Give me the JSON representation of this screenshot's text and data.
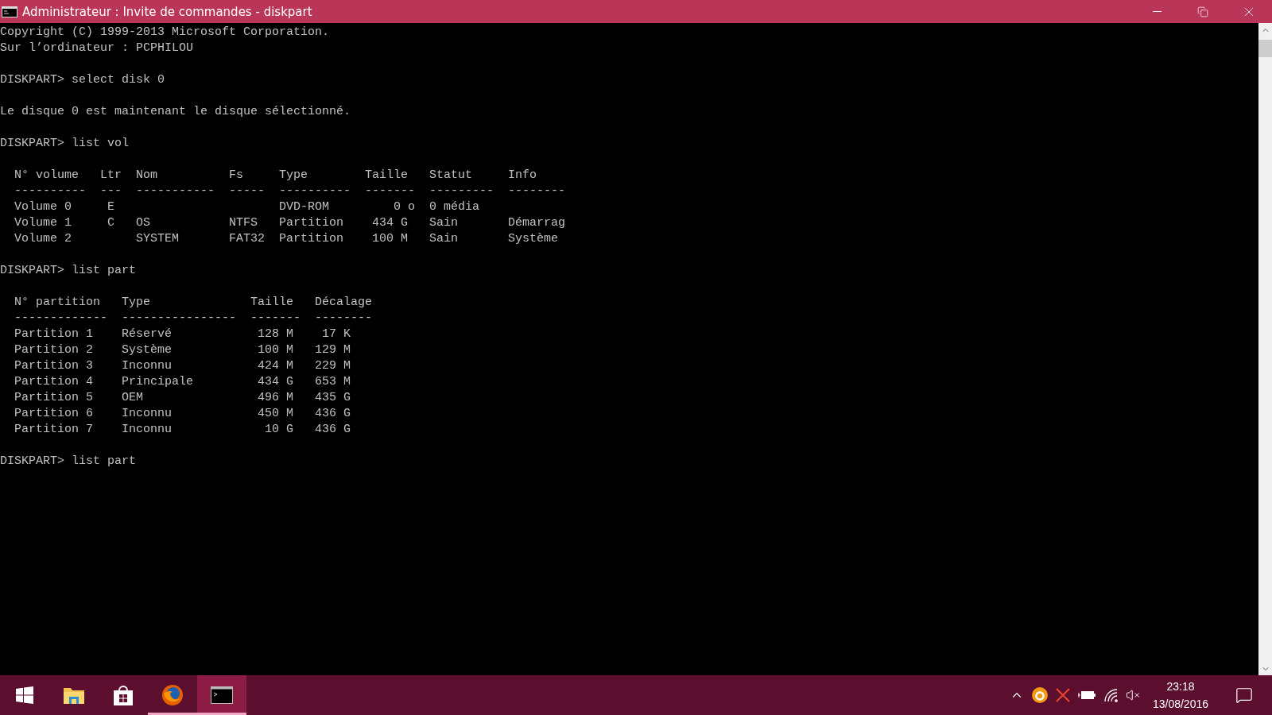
{
  "window": {
    "title": "Administrateur : Invite de commandes - diskpart"
  },
  "console": {
    "blocks": [
      [
        "Copyright (C) 1999-2013 Microsoft Corporation.",
        "Sur l’ordinateur : PCPHILOU"
      ],
      [
        "DISKPART> select disk 0"
      ],
      [
        "Le disque 0 est maintenant le disque sélectionné."
      ],
      [
        "DISKPART> list vol"
      ],
      [
        "  N° volume   Ltr  Nom          Fs     Type        Taille   Statut     Info",
        "  ----------  ---  -----------  -----  ----------  -------  ---------  --------",
        "  Volume 0     E                       DVD-ROM         0 o  0 média",
        "  Volume 1     C   OS           NTFS   Partition    434 G   Sain       Démarrag",
        "  Volume 2         SYSTEM       FAT32  Partition    100 M   Sain       Système"
      ],
      [
        "DISKPART> list part"
      ],
      [
        "  N° partition   Type              Taille   Décalage",
        "  -------------  ----------------  -------  --------",
        "  Partition 1    Réservé            128 M    17 K",
        "  Partition 2    Système            100 M   129 M",
        "  Partition 3    Inconnu            424 M   229 M",
        "  Partition 4    Principale         434 G   653 M",
        "  Partition 5    OEM                496 M   435 G",
        "  Partition 6    Inconnu            450 M   436 G",
        "  Partition 7    Inconnu             10 G   436 G"
      ],
      [
        "DISKPART> list part"
      ]
    ]
  },
  "taskbar": {
    "apps": [
      {
        "kind": "start",
        "running": false,
        "active": false
      },
      {
        "kind": "explorer",
        "running": false,
        "active": false
      },
      {
        "kind": "store",
        "running": false,
        "active": false
      },
      {
        "kind": "firefox",
        "running": true,
        "active": false
      },
      {
        "kind": "terminal",
        "running": true,
        "active": true
      }
    ],
    "time": "23:18",
    "date": "13/08/2016"
  }
}
